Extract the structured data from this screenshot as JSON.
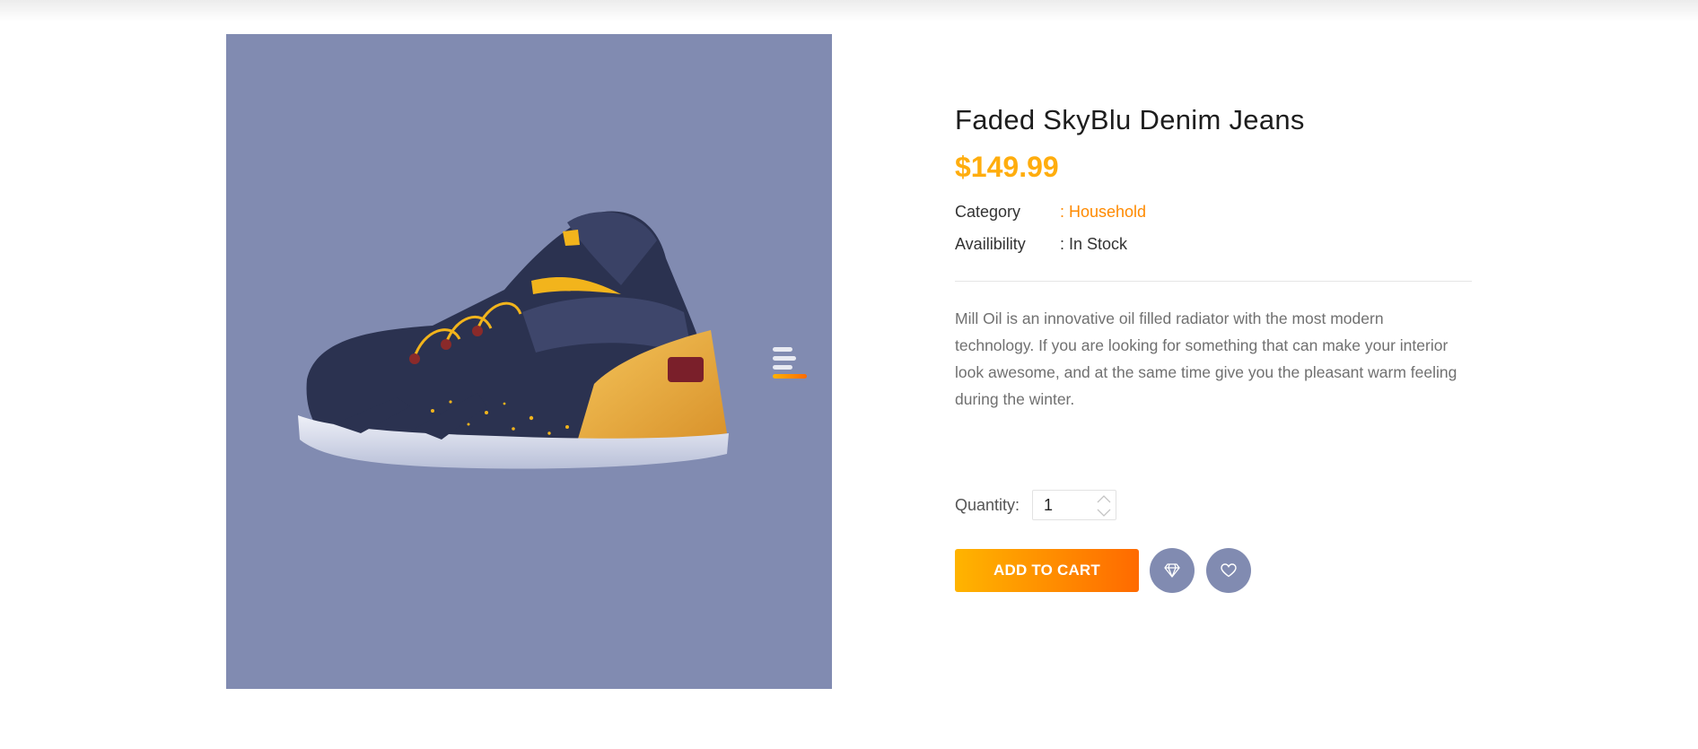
{
  "product": {
    "title": "Faded SkyBlu Denim Jeans",
    "price": "$149.99",
    "category_label": "Category",
    "category_value": ": Household",
    "availability_label": "Availibility",
    "availability_value": ": In Stock",
    "description": "Mill Oil is an innovative oil filled radiator with the most modern technology. If you are looking for something that can make your interior look awesome, and at the same time give you the pleasant warm feeling during the winter."
  },
  "purchase": {
    "quantity_label": "Quantity:",
    "quantity_value": "1",
    "add_to_cart_label": "ADD TO CART"
  },
  "icons": {
    "compare": "diamond-icon",
    "wishlist": "heart-icon",
    "slider": "slider-menu-icon"
  },
  "colors": {
    "accent": "#ffad0d",
    "accent_gradient_end": "#ff6a00",
    "gallery_bg": "#818bb1",
    "category_link": "#ff8a00"
  }
}
